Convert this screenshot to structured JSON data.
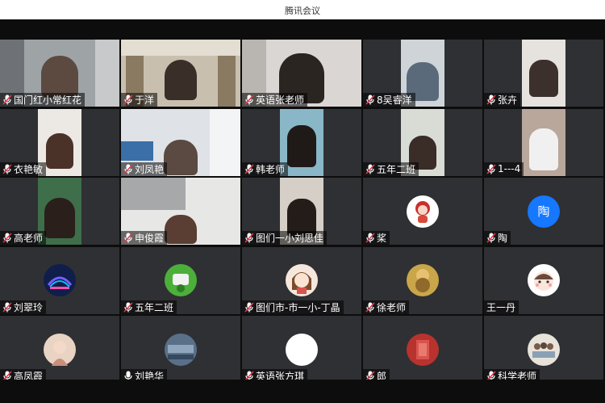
{
  "window": {
    "title": "腾讯会议"
  },
  "participants": [
    {
      "name": "国门红小常红花"
    },
    {
      "name": "于洋"
    },
    {
      "name": "英语张老师"
    },
    {
      "name": "8吴睿洋"
    },
    {
      "name": "张卉"
    },
    {
      "name": "衣艳敏"
    },
    {
      "name": "刘凤艳"
    },
    {
      "name": "韩老师"
    },
    {
      "name": "五年二班"
    },
    {
      "name": "1---4"
    },
    {
      "name": "高老师"
    },
    {
      "name": "申俊霞"
    },
    {
      "name": "图们一小刘思佳"
    },
    {
      "name": "桨"
    },
    {
      "name": "陶",
      "avatar_text": "陶"
    },
    {
      "name": "刘翠玲"
    },
    {
      "name": "五年二班"
    },
    {
      "name": "图们市-市一小-丁晶"
    },
    {
      "name": "徐老师"
    },
    {
      "name": "王一丹"
    },
    {
      "name": "高凤霞"
    },
    {
      "name": "刘艳华"
    },
    {
      "name": "英语张方琪"
    },
    {
      "name": "郎"
    },
    {
      "name": "科学老师"
    }
  ],
  "colors": {
    "mic_muted": "#e0394a",
    "mic_on": "#ffffff",
    "avatar_blue": "#1677ff"
  }
}
